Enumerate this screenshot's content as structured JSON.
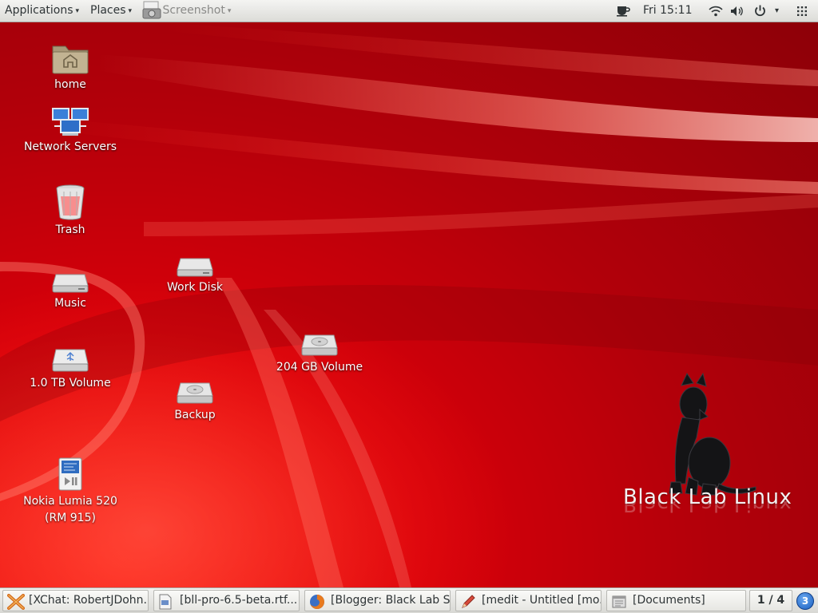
{
  "top_panel": {
    "applications_label": "Applications",
    "places_label": "Places",
    "active_app_label": "Screenshot",
    "clock": "Fri 15:11"
  },
  "desktop": {
    "icons": [
      {
        "label": "home",
        "icon": "home-folder-icon"
      },
      {
        "label": "Network Servers",
        "icon": "network-servers-icon"
      },
      {
        "label": "Trash",
        "icon": "trash-icon"
      },
      {
        "label": "Music",
        "icon": "drive-icon"
      },
      {
        "label": "1.0 TB Volume",
        "icon": "usb-drive-icon"
      },
      {
        "label": "Nokia Lumia 520\n(RM 915)",
        "icon": "media-player-icon"
      },
      {
        "label": "Work Disk",
        "icon": "drive-icon"
      },
      {
        "label": "Backup",
        "icon": "hard-disk-icon"
      },
      {
        "label": "204 GB Volume",
        "icon": "hard-disk-icon"
      }
    ],
    "brand_text": "Black Lab Linux"
  },
  "taskbar": {
    "tasks": [
      {
        "label": "[XChat: RobertJDohn...",
        "icon": "xchat-icon"
      },
      {
        "label": "[bll-pro-6.5-beta.rtf...",
        "icon": "document-icon"
      },
      {
        "label": "[Blogger: Black Lab S...",
        "icon": "firefox-icon"
      },
      {
        "label": "[medit - Untitled [mo...",
        "icon": "medit-pen-icon"
      },
      {
        "label": "[Documents]",
        "icon": "file-manager-icon"
      }
    ],
    "workspace": "1 / 4",
    "notification_count": "3"
  },
  "colors": {
    "wallpaper_red": "#c0000a",
    "panel_bg": "#e6e6e2",
    "label_text": "#ffffff"
  }
}
